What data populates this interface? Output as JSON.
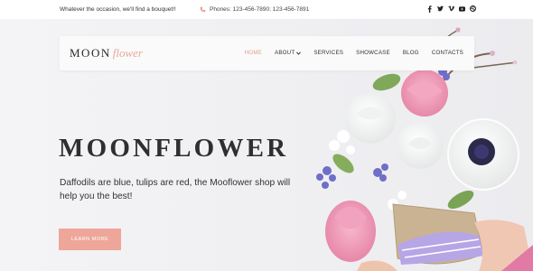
{
  "topbar": {
    "tagline": "Whatever the occasion, we'll find a bouquet!!",
    "phones": "Phones: 123-456-7890; 123-456-7891",
    "social_icons": [
      "facebook-icon",
      "twitter-icon",
      "vimeo-icon",
      "youtube-icon",
      "dribbble-icon"
    ]
  },
  "logo": {
    "part1": "MOON",
    "part2": "flower"
  },
  "nav": {
    "home": "HOME",
    "about": "ABOUT",
    "services": "SERVICES",
    "showcase": "SHOWCASE",
    "blog": "BLOG",
    "contacts": "CONTACTS"
  },
  "hero": {
    "title": "MOONFLOWER",
    "subtitle": "Daffodils are blue, tulips are red, the Mooflower shop will help you the best!",
    "cta": "LEARN MORE"
  },
  "colors": {
    "accent": "#eea69a",
    "active_nav": "#e89c8b",
    "text": "#333333",
    "background": "#f3f3f4"
  }
}
